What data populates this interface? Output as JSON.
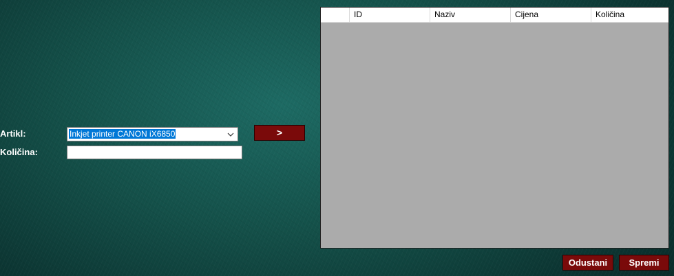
{
  "form": {
    "artikl_label": "Artikl:",
    "kolicina_label": "Količina:",
    "artikl_selected": "Inkjet printer CANON iX6850",
    "kolicina_value": ""
  },
  "buttons": {
    "add_label": ">",
    "cancel_label": "Odustani",
    "save_label": "Spremi"
  },
  "grid": {
    "columns": [
      "",
      "ID",
      "Naziv",
      "Cijena",
      "Količina"
    ],
    "rows": []
  },
  "colors": {
    "button_bg": "#7a0a0a",
    "grid_bg": "#ababab",
    "selection": "#0078d7"
  },
  "icons": {
    "dropdown": "chevron-down-icon"
  }
}
